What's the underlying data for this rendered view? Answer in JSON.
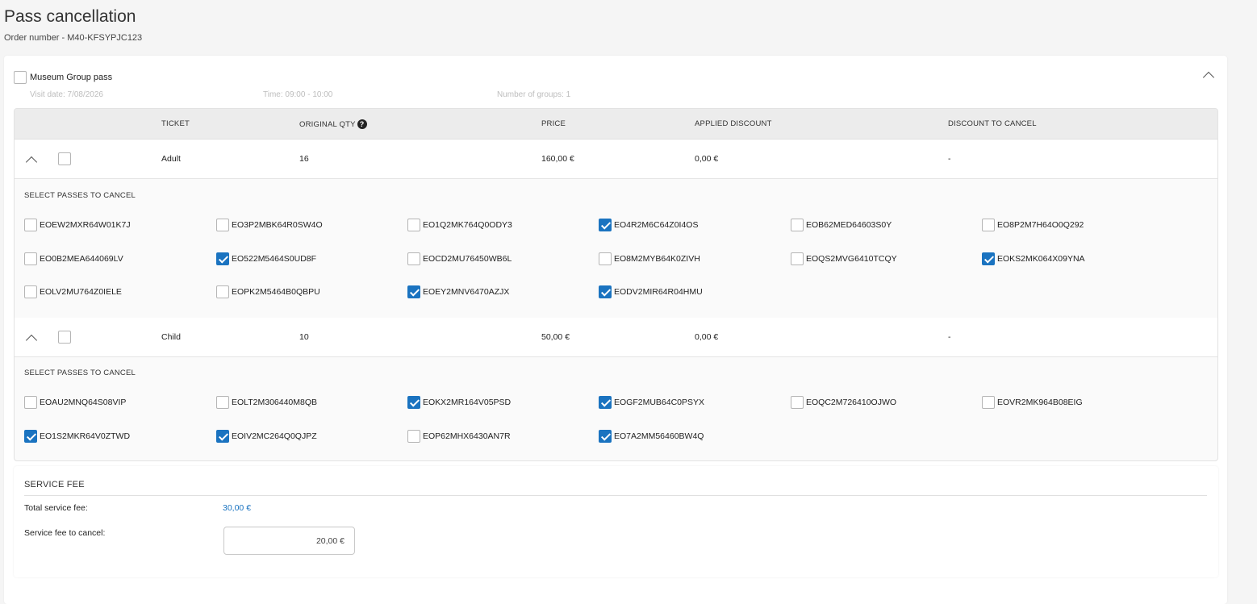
{
  "page": {
    "title": "Pass cancellation",
    "order_number": "Order number - M40-KFSYPJC123"
  },
  "pass_card": {
    "title": "Museum Group pass",
    "visit_date": "Visit date: 7/08/2026",
    "time": "Time: 09:00 - 10:00",
    "groups": "Number of groups: 1"
  },
  "table": {
    "headers": {
      "ticket": "TICKET",
      "original_qty": "ORIGINAL QTY",
      "price": "PRICE",
      "applied_discount": "APPLIED DISCOUNT",
      "discount_to_cancel": "DISCOUNT TO CANCEL"
    },
    "help_glyph": "?",
    "select_label": "SELECT PASSES TO CANCEL",
    "rows": [
      {
        "ticket": "Adult",
        "qty": "16",
        "price": "160,00 €",
        "discount": "0,00 €",
        "discount_to_cancel": "-",
        "passes": [
          {
            "code": "EOEW2MXR64W01K7J",
            "checked": false
          },
          {
            "code": "EO3P2MBK64R0SW4O",
            "checked": false
          },
          {
            "code": "EO1Q2MK764Q0ODY3",
            "checked": false
          },
          {
            "code": "EO4R2M6C64Z0I4OS",
            "checked": true
          },
          {
            "code": "EOB62MED64603S0Y",
            "checked": false
          },
          {
            "code": "EO8P2M7H64O0Q292",
            "checked": false
          },
          {
            "code": "EO0B2MEA644069LV",
            "checked": false
          },
          {
            "code": "EO522M5464S0UD8F",
            "checked": true
          },
          {
            "code": "EOCD2MU76450WB6L",
            "checked": false
          },
          {
            "code": "EO8M2MYB64K0ZIVH",
            "checked": false
          },
          {
            "code": "EOQS2MVG6410TCQY",
            "checked": false
          },
          {
            "code": "EOKS2MK064X09YNA",
            "checked": true
          },
          {
            "code": "EOLV2MU764Z0IELE",
            "checked": false
          },
          {
            "code": "EOPK2M5464B0QBPU",
            "checked": false
          },
          {
            "code": "EOEY2MNV6470AZJX",
            "checked": true
          },
          {
            "code": "EODV2MIR64R04HMU",
            "checked": true
          }
        ]
      },
      {
        "ticket": "Child",
        "qty": "10",
        "price": "50,00 €",
        "discount": "0,00 €",
        "discount_to_cancel": "-",
        "passes": [
          {
            "code": "EOAU2MNQ64S08VIP",
            "checked": false
          },
          {
            "code": "EOLT2M306440M8QB",
            "checked": false
          },
          {
            "code": "EOKX2MR164V05PSD",
            "checked": true
          },
          {
            "code": "EOGF2MUB64C0PSYX",
            "checked": true
          },
          {
            "code": "EOQC2M726410OJWO",
            "checked": false
          },
          {
            "code": "EOVR2MK964B08EIG",
            "checked": false
          },
          {
            "code": "EO1S2MKR64V0ZTWD",
            "checked": true
          },
          {
            "code": "EOIV2MC264Q0QJPZ",
            "checked": true
          },
          {
            "code": "EOP62MHX6430AN7R",
            "checked": false
          },
          {
            "code": "EO7A2MM56460BW4Q",
            "checked": true
          }
        ]
      }
    ]
  },
  "service_fee": {
    "title": "SERVICE FEE",
    "total_label": "Total service fee:",
    "total_value": "30,00 €",
    "cancel_label": "Service fee to cancel:",
    "cancel_value": "20,00 €"
  },
  "colors": {
    "accent": "#1a73c0"
  }
}
